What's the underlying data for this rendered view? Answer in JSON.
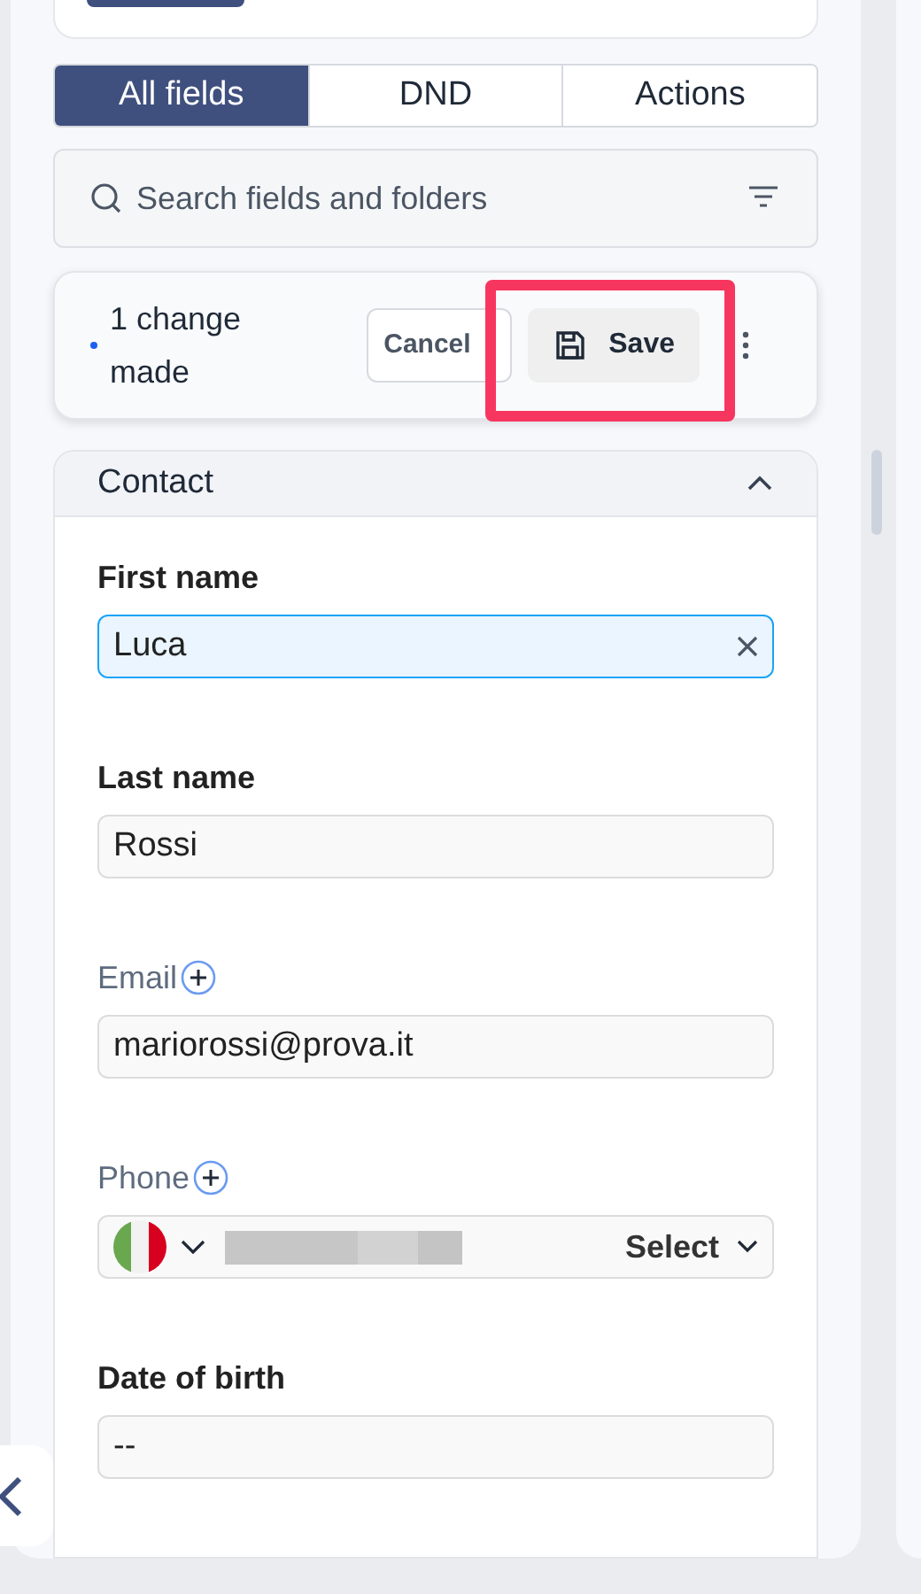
{
  "tabs": [
    {
      "label": "All fields",
      "selected": true
    },
    {
      "label": "DND",
      "selected": false
    },
    {
      "label": "Actions",
      "selected": false
    }
  ],
  "search": {
    "placeholder": "Search fields and folders"
  },
  "changes": {
    "message": "1 change made",
    "cancel": "Cancel",
    "save": "Save",
    "highlighted": true
  },
  "section": {
    "title": "Contact",
    "expanded": true,
    "fields": [
      {
        "kind": "text",
        "label": "First name",
        "value": "Luca",
        "focused": true
      },
      {
        "kind": "text",
        "label": "Last name",
        "value": "Rossi",
        "focused": false
      },
      {
        "kind": "multi",
        "label": "Email",
        "value": "mariorossi@prova.it",
        "focused": false
      },
      {
        "kind": "phone",
        "label": "Phone",
        "type_select": "Select",
        "focused": false
      },
      {
        "kind": "text",
        "label": "Date of birth",
        "value": "--",
        "focused": false
      }
    ]
  }
}
